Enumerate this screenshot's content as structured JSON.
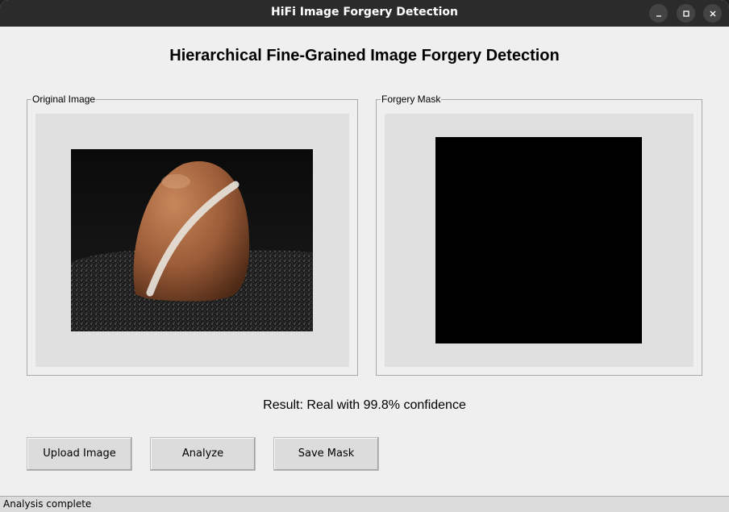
{
  "window": {
    "title": "HiFi Image Forgery Detection"
  },
  "header": {
    "title": "Hierarchical Fine-Grained Image Forgery Detection"
  },
  "panels": {
    "original": {
      "label": "Original Image"
    },
    "mask": {
      "label": "Forgery Mask"
    }
  },
  "result": {
    "text": "Result: Real with 99.8% confidence"
  },
  "buttons": {
    "upload": "Upload Image",
    "analyze": "Analyze",
    "save": "Save Mask"
  },
  "status": {
    "text": "Analysis complete"
  },
  "icons": {
    "minimize": "minimize-icon",
    "maximize": "maximize-icon",
    "close": "close-icon"
  },
  "colors": {
    "titlebar": "#2b2b2b",
    "window_bg": "#efefef",
    "canvas_bg": "#e0e0e0",
    "mask": "#000000"
  }
}
